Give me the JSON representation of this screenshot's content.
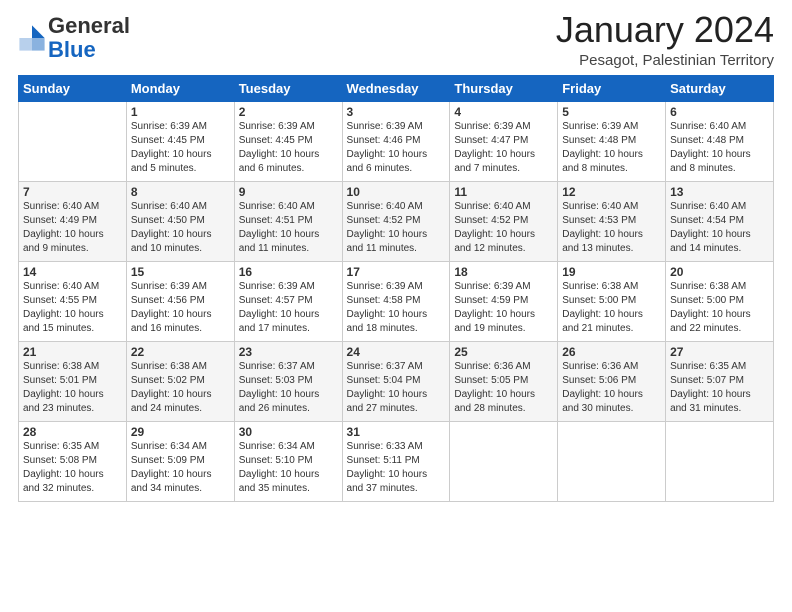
{
  "header": {
    "logo_general": "General",
    "logo_blue": "Blue",
    "month_title": "January 2024",
    "subtitle": "Pesagot, Palestinian Territory"
  },
  "days_of_week": [
    "Sunday",
    "Monday",
    "Tuesday",
    "Wednesday",
    "Thursday",
    "Friday",
    "Saturday"
  ],
  "weeks": [
    [
      {
        "num": "",
        "info": ""
      },
      {
        "num": "1",
        "info": "Sunrise: 6:39 AM\nSunset: 4:45 PM\nDaylight: 10 hours\nand 5 minutes."
      },
      {
        "num": "2",
        "info": "Sunrise: 6:39 AM\nSunset: 4:45 PM\nDaylight: 10 hours\nand 6 minutes."
      },
      {
        "num": "3",
        "info": "Sunrise: 6:39 AM\nSunset: 4:46 PM\nDaylight: 10 hours\nand 6 minutes."
      },
      {
        "num": "4",
        "info": "Sunrise: 6:39 AM\nSunset: 4:47 PM\nDaylight: 10 hours\nand 7 minutes."
      },
      {
        "num": "5",
        "info": "Sunrise: 6:39 AM\nSunset: 4:48 PM\nDaylight: 10 hours\nand 8 minutes."
      },
      {
        "num": "6",
        "info": "Sunrise: 6:40 AM\nSunset: 4:48 PM\nDaylight: 10 hours\nand 8 minutes."
      }
    ],
    [
      {
        "num": "7",
        "info": "Sunrise: 6:40 AM\nSunset: 4:49 PM\nDaylight: 10 hours\nand 9 minutes."
      },
      {
        "num": "8",
        "info": "Sunrise: 6:40 AM\nSunset: 4:50 PM\nDaylight: 10 hours\nand 10 minutes."
      },
      {
        "num": "9",
        "info": "Sunrise: 6:40 AM\nSunset: 4:51 PM\nDaylight: 10 hours\nand 11 minutes."
      },
      {
        "num": "10",
        "info": "Sunrise: 6:40 AM\nSunset: 4:52 PM\nDaylight: 10 hours\nand 11 minutes."
      },
      {
        "num": "11",
        "info": "Sunrise: 6:40 AM\nSunset: 4:52 PM\nDaylight: 10 hours\nand 12 minutes."
      },
      {
        "num": "12",
        "info": "Sunrise: 6:40 AM\nSunset: 4:53 PM\nDaylight: 10 hours\nand 13 minutes."
      },
      {
        "num": "13",
        "info": "Sunrise: 6:40 AM\nSunset: 4:54 PM\nDaylight: 10 hours\nand 14 minutes."
      }
    ],
    [
      {
        "num": "14",
        "info": "Sunrise: 6:40 AM\nSunset: 4:55 PM\nDaylight: 10 hours\nand 15 minutes."
      },
      {
        "num": "15",
        "info": "Sunrise: 6:39 AM\nSunset: 4:56 PM\nDaylight: 10 hours\nand 16 minutes."
      },
      {
        "num": "16",
        "info": "Sunrise: 6:39 AM\nSunset: 4:57 PM\nDaylight: 10 hours\nand 17 minutes."
      },
      {
        "num": "17",
        "info": "Sunrise: 6:39 AM\nSunset: 4:58 PM\nDaylight: 10 hours\nand 18 minutes."
      },
      {
        "num": "18",
        "info": "Sunrise: 6:39 AM\nSunset: 4:59 PM\nDaylight: 10 hours\nand 19 minutes."
      },
      {
        "num": "19",
        "info": "Sunrise: 6:38 AM\nSunset: 5:00 PM\nDaylight: 10 hours\nand 21 minutes."
      },
      {
        "num": "20",
        "info": "Sunrise: 6:38 AM\nSunset: 5:00 PM\nDaylight: 10 hours\nand 22 minutes."
      }
    ],
    [
      {
        "num": "21",
        "info": "Sunrise: 6:38 AM\nSunset: 5:01 PM\nDaylight: 10 hours\nand 23 minutes."
      },
      {
        "num": "22",
        "info": "Sunrise: 6:38 AM\nSunset: 5:02 PM\nDaylight: 10 hours\nand 24 minutes."
      },
      {
        "num": "23",
        "info": "Sunrise: 6:37 AM\nSunset: 5:03 PM\nDaylight: 10 hours\nand 26 minutes."
      },
      {
        "num": "24",
        "info": "Sunrise: 6:37 AM\nSunset: 5:04 PM\nDaylight: 10 hours\nand 27 minutes."
      },
      {
        "num": "25",
        "info": "Sunrise: 6:36 AM\nSunset: 5:05 PM\nDaylight: 10 hours\nand 28 minutes."
      },
      {
        "num": "26",
        "info": "Sunrise: 6:36 AM\nSunset: 5:06 PM\nDaylight: 10 hours\nand 30 minutes."
      },
      {
        "num": "27",
        "info": "Sunrise: 6:35 AM\nSunset: 5:07 PM\nDaylight: 10 hours\nand 31 minutes."
      }
    ],
    [
      {
        "num": "28",
        "info": "Sunrise: 6:35 AM\nSunset: 5:08 PM\nDaylight: 10 hours\nand 32 minutes."
      },
      {
        "num": "29",
        "info": "Sunrise: 6:34 AM\nSunset: 5:09 PM\nDaylight: 10 hours\nand 34 minutes."
      },
      {
        "num": "30",
        "info": "Sunrise: 6:34 AM\nSunset: 5:10 PM\nDaylight: 10 hours\nand 35 minutes."
      },
      {
        "num": "31",
        "info": "Sunrise: 6:33 AM\nSunset: 5:11 PM\nDaylight: 10 hours\nand 37 minutes."
      },
      {
        "num": "",
        "info": ""
      },
      {
        "num": "",
        "info": ""
      },
      {
        "num": "",
        "info": ""
      }
    ]
  ]
}
